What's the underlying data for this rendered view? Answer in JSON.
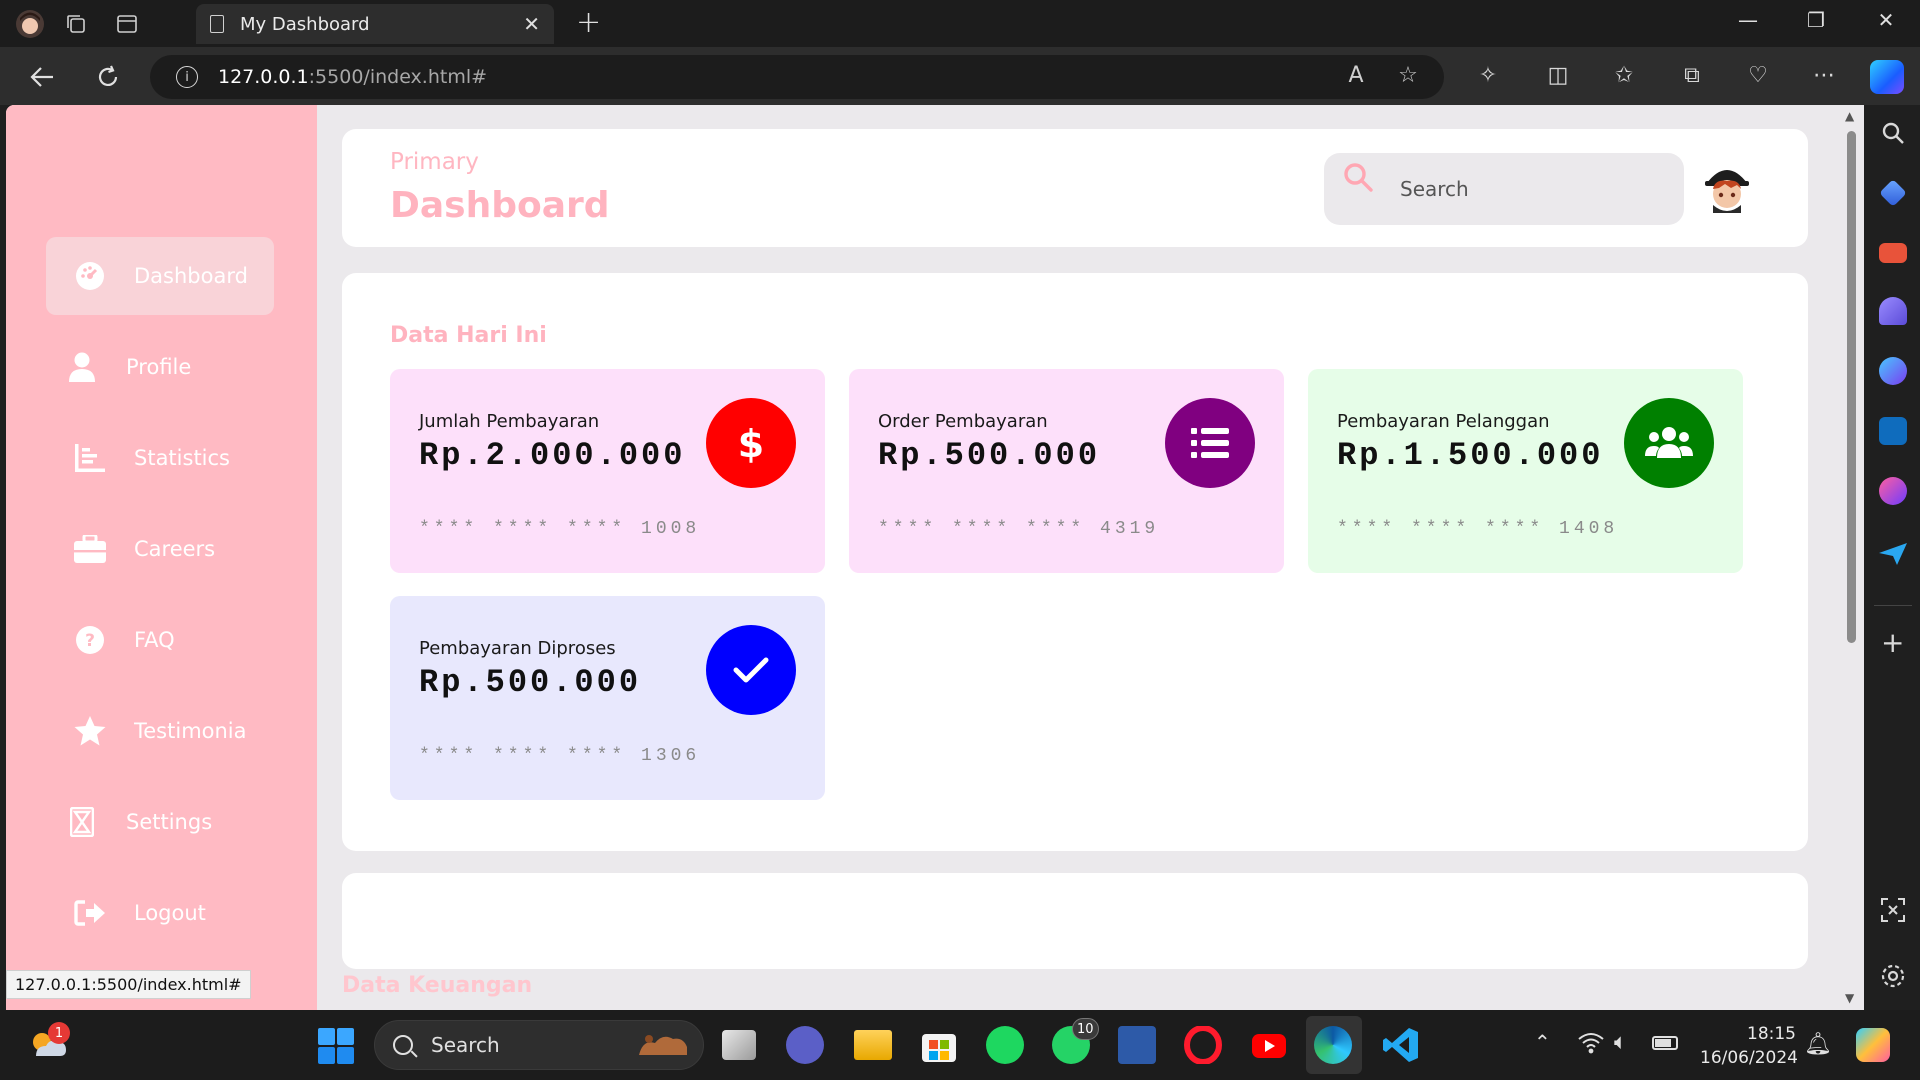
{
  "browser": {
    "tab_title": "My Dashboard",
    "url_host": "127.0.0.1",
    "url_path": ":5500/index.html#",
    "status_url": "127.0.0.1:5500/index.html#"
  },
  "sidebar": {
    "items": [
      {
        "label": "Dashboard",
        "icon": "gauge-icon",
        "active": true
      },
      {
        "label": "Profile",
        "icon": "user-icon"
      },
      {
        "label": "Statistics",
        "icon": "bar-chart-icon"
      },
      {
        "label": "Careers",
        "icon": "briefcase-icon"
      },
      {
        "label": "FAQ",
        "icon": "question-icon"
      },
      {
        "label": "Testimonia",
        "icon": "star-icon"
      },
      {
        "label": "Settings",
        "icon": "hourglass-icon"
      },
      {
        "label": "Logout",
        "icon": "logout-icon"
      }
    ]
  },
  "header": {
    "subtitle": "Primary",
    "title": "Dashboard",
    "search_placeholder": "Search"
  },
  "data_section": {
    "title": "Data Hari Ini",
    "cards": [
      {
        "label": "Jumlah Pembayaran",
        "value": "Rp.2.000.000",
        "card": "**** **** **** 1008",
        "icon": "dollar-icon",
        "bg": "#fde0fa",
        "circle": "#ff0000"
      },
      {
        "label": "Order Pembayaran",
        "value": "Rp.500.000",
        "card": "**** **** **** 4319",
        "icon": "list-icon",
        "bg": "#fde0fa",
        "circle": "#800080"
      },
      {
        "label": "Pembayaran Pelanggan",
        "value": "Rp.1.500.000",
        "card": "**** **** **** 1408",
        "icon": "users-icon",
        "bg": "#e6fde8",
        "circle": "#008000"
      },
      {
        "label": "Pembayaran Diproses",
        "value": "Rp.500.000",
        "card": "**** **** **** 1306",
        "icon": "check-icon",
        "bg": "#e8e8fd",
        "circle": "#0000ff"
      }
    ]
  },
  "finance_section": {
    "title": "Data Keuangan"
  },
  "taskbar": {
    "search_label": "Search",
    "time": "18:15",
    "date": "16/06/2024",
    "weather_badge": "1",
    "whatsapp_badge": "10"
  }
}
